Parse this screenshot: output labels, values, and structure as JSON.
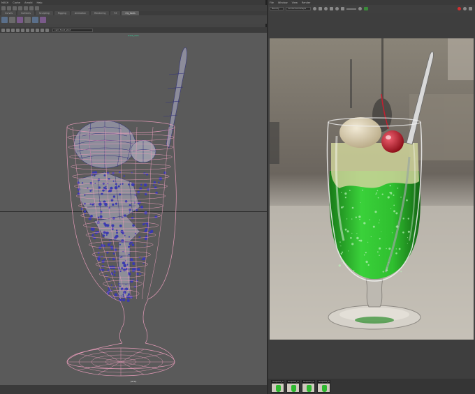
{
  "left_app": {
    "menu": [
      "MASH",
      "Cache",
      "Arnold",
      "Help"
    ],
    "shelf_tabs": [
      {
        "label": "Curves",
        "active": false
      },
      {
        "label": "Surfaces",
        "active": false
      },
      {
        "label": "Sculpting",
        "active": false
      },
      {
        "label": "Rigging",
        "active": false
      },
      {
        "label": "Animation",
        "active": false
      },
      {
        "label": "Rendering",
        "active": false
      },
      {
        "label": "FX",
        "active": false
      },
      {
        "label": "my_tools",
        "active": true
      }
    ],
    "camera_field": "cam_front_shot",
    "viewport": {
      "camera_label": "front_cam",
      "view_label": "persp"
    },
    "wire_color": "#e59bb8",
    "vertex_color": "#2a2a9a",
    "background": "#5a5a5a"
  },
  "right_app": {
    "menu": [
      "File",
      "Window",
      "View",
      "Render"
    ],
    "renderer_dropdown": "Beauty",
    "camera_dropdown": "renderCamShape",
    "liquid_color": "#2fbf2f",
    "cherry_color": "#c8202a",
    "snapshots": [
      {
        "label": "Snapshot_01"
      },
      {
        "label": "Snapshot_02"
      },
      {
        "label": "Snapshot_03"
      },
      {
        "label": "Snapshot_04"
      }
    ]
  }
}
